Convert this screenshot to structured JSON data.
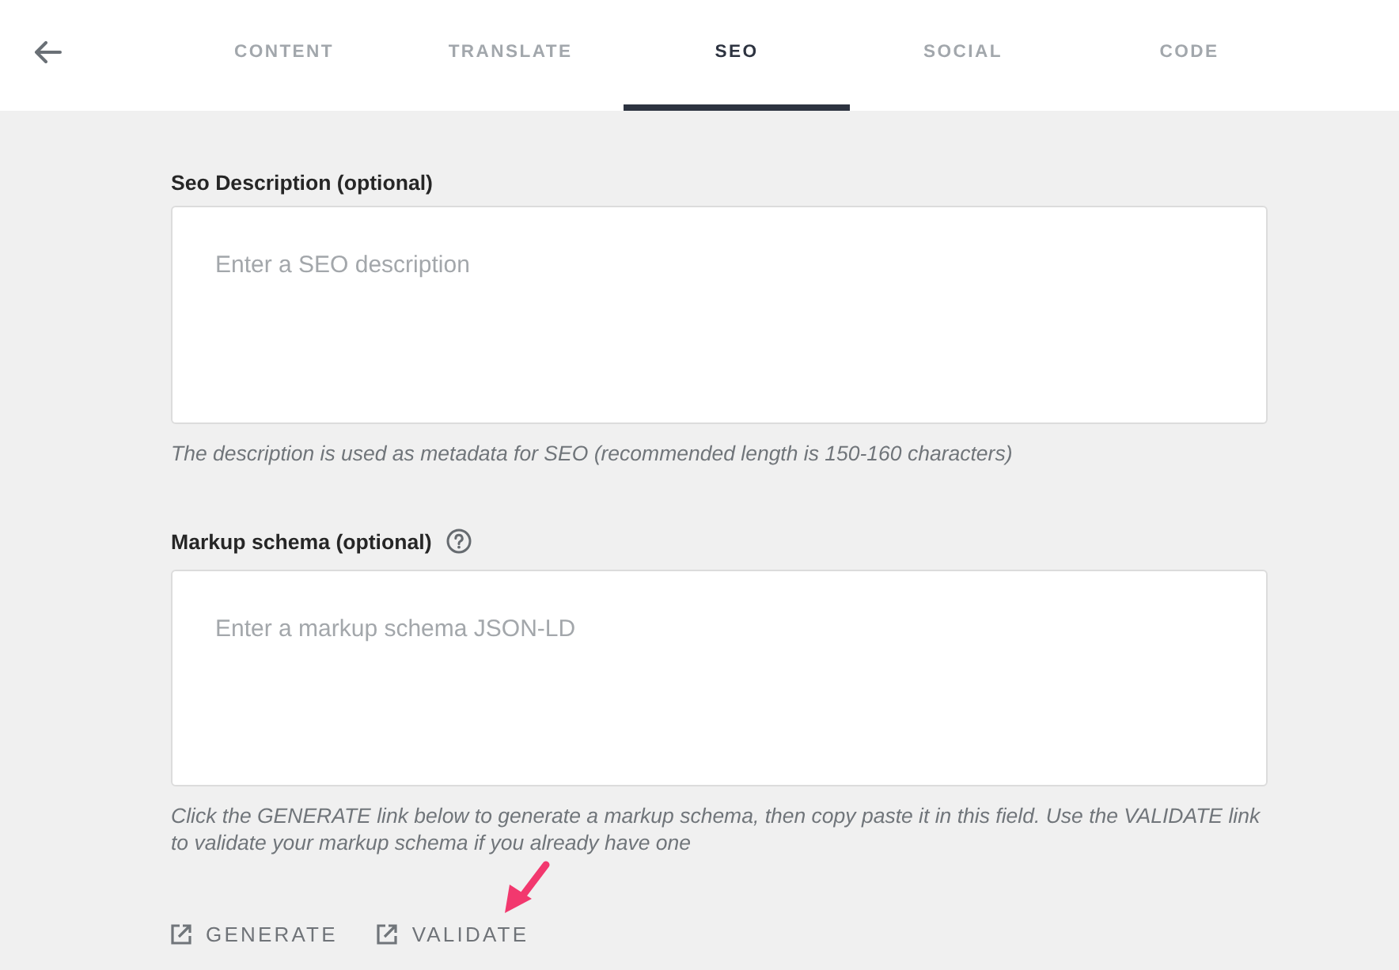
{
  "tabs": [
    {
      "label": "CONTENT",
      "selected": false
    },
    {
      "label": "TRANSLATE",
      "selected": false
    },
    {
      "label": "SEO",
      "selected": true
    },
    {
      "label": "SOCIAL",
      "selected": false
    },
    {
      "label": "CODE",
      "selected": false
    }
  ],
  "seo_description": {
    "label": "Seo Description (optional)",
    "placeholder": "Enter a SEO description",
    "hint": "The description is used as metadata for SEO (recommended length is 150-160 characters)"
  },
  "markup_schema": {
    "label": "Markup schema (optional)",
    "help": true,
    "placeholder": "Enter a markup schema JSON-LD",
    "hint": "Click the GENERATE link below to generate a markup schema, then copy paste it in this field. Use the VALIDATE link to validate your markup schema if you already have one",
    "links": [
      {
        "label": "GENERATE"
      },
      {
        "label": "VALIDATE"
      }
    ]
  }
}
